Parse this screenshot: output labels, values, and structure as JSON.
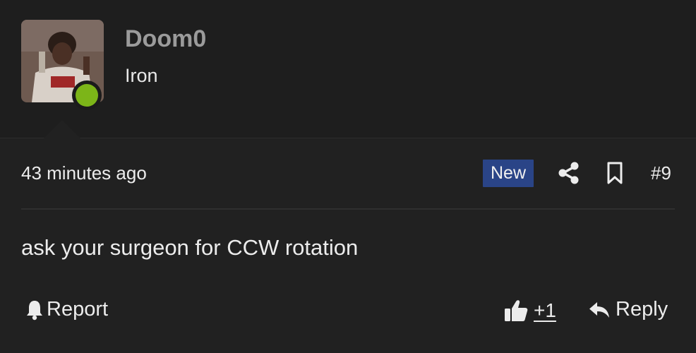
{
  "user": {
    "name": "Doom0",
    "title": "Iron",
    "status": "online",
    "status_color": "#7cb518"
  },
  "post": {
    "timestamp": "43 minutes ago",
    "badge": "New",
    "badge_color": "#2a4487",
    "number": "#9",
    "body": "ask your surgeon for CCW rotation"
  },
  "actions": {
    "report_label": "Report",
    "like_count": "+1",
    "reply_label": "Reply"
  },
  "icons": [
    "share-icon",
    "bookmark-icon",
    "bell-icon",
    "thumbs-up-icon",
    "reply-arrow-icon"
  ]
}
